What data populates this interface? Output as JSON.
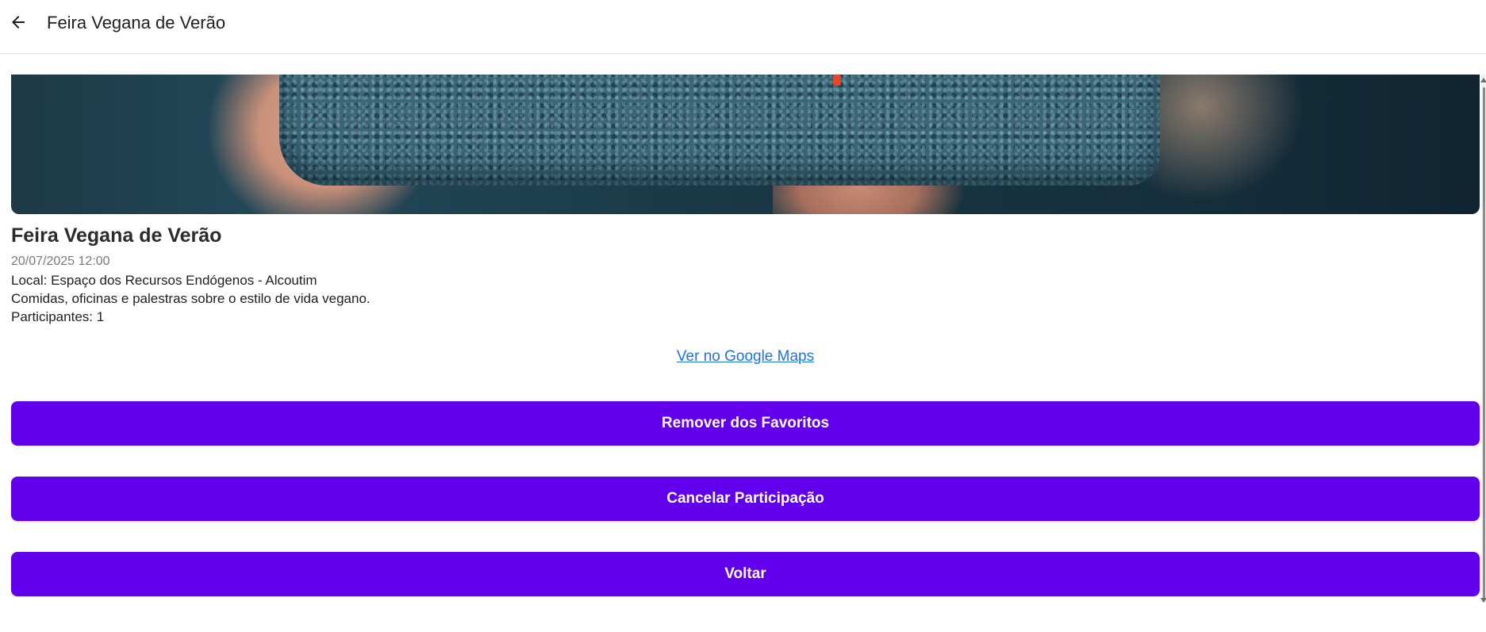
{
  "header": {
    "back_icon": "arrow-left-icon",
    "title": "Feira Vegana de Verão"
  },
  "event": {
    "title": "Feira Vegana de Verão",
    "datetime": "20/07/2025 12:00",
    "location": "Local: Espaço dos Recursos Endógenos - Alcoutim",
    "description": "Comidas, oficinas e palestras sobre o estilo de vida vegano.",
    "participants": "Participantes: 1",
    "maps_link": "Ver no Google Maps"
  },
  "actions": {
    "remove_favorites": "Remover dos Favoritos",
    "cancel_participation": "Cancelar Participação",
    "back": "Voltar"
  },
  "colors": {
    "primary": "#6200ee",
    "link": "#1a73e8"
  }
}
